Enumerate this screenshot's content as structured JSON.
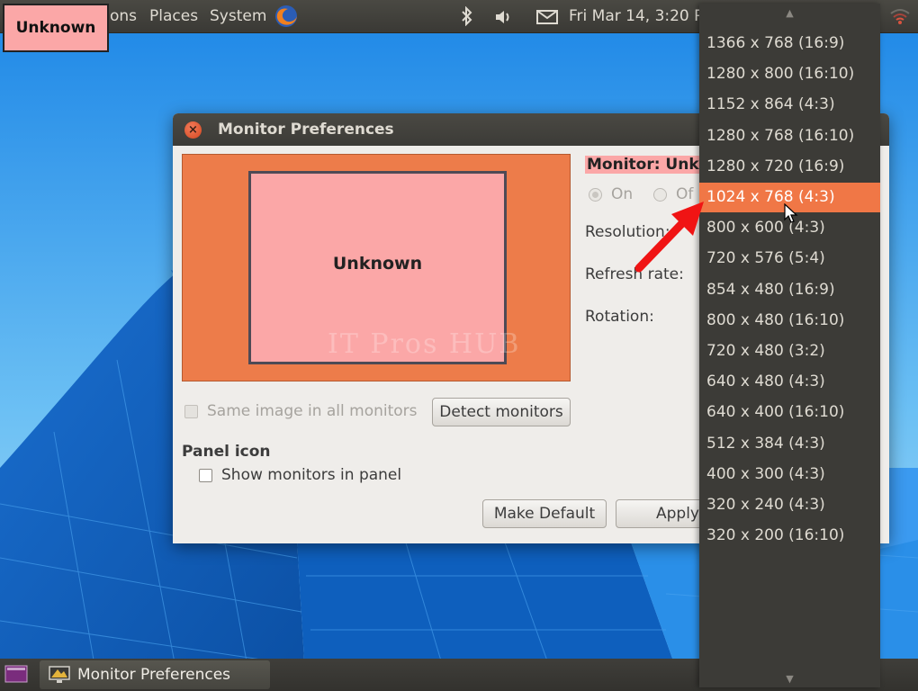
{
  "top_panel": {
    "applications_partial": "ons",
    "places": "Places",
    "system": "System",
    "clock": "Fri Mar 14,  3:20 P",
    "icons": [
      "firefox-icon",
      "bluetooth-icon",
      "volume-icon",
      "mail-icon",
      "wifi-icon"
    ]
  },
  "workspace_badge": "Unknown",
  "window": {
    "title": "Monitor Preferences",
    "preview_monitor_label": "Unknown",
    "monitor_label": "Monitor: Unkn",
    "on_label": "On",
    "off_label": "Of",
    "resolution_label": "Resolution:",
    "refresh_label": "Refresh rate:",
    "rotation_label": "Rotation:",
    "same_image_label": "Same image in all monitors",
    "detect_button": "Detect monitors",
    "panel_icon_heading": "Panel icon",
    "show_monitors_label": "Show monitors in panel",
    "make_default_button": "Make Default",
    "apply_button": "Apply"
  },
  "watermark": "IT Pros HUB",
  "resolution_options": [
    {
      "label": "1366 x 768 (16:9)",
      "selected": false
    },
    {
      "label": "1280 x 800 (16:10)",
      "selected": false
    },
    {
      "label": "1152 x 864 (4:3)",
      "selected": false
    },
    {
      "label": "1280 x 768 (16:10)",
      "selected": false
    },
    {
      "label": "1280 x 720 (16:9)",
      "selected": false
    },
    {
      "label": "1024 x 768 (4:3)",
      "selected": true
    },
    {
      "label": "800 x 600 (4:3)",
      "selected": false
    },
    {
      "label": "720 x 576 (5:4)",
      "selected": false
    },
    {
      "label": "854 x 480 (16:9)",
      "selected": false
    },
    {
      "label": "800 x 480 (16:10)",
      "selected": false
    },
    {
      "label": "720 x 480 (3:2)",
      "selected": false
    },
    {
      "label": "640 x 480 (4:3)",
      "selected": false
    },
    {
      "label": "640 x 400 (16:10)",
      "selected": false
    },
    {
      "label": "512 x 384 (4:3)",
      "selected": false
    },
    {
      "label": "400 x 300 (4:3)",
      "selected": false
    },
    {
      "label": "320 x 240 (4:3)",
      "selected": false
    },
    {
      "label": "320 x 200 (16:10)",
      "selected": false
    }
  ],
  "taskbar": {
    "task_label": "Monitor Preferences"
  },
  "colors": {
    "accent": "#f07746",
    "preview_bg": "#ed7c4a",
    "monitor_fill": "#fba7a7",
    "panel": "#3c3b37"
  }
}
